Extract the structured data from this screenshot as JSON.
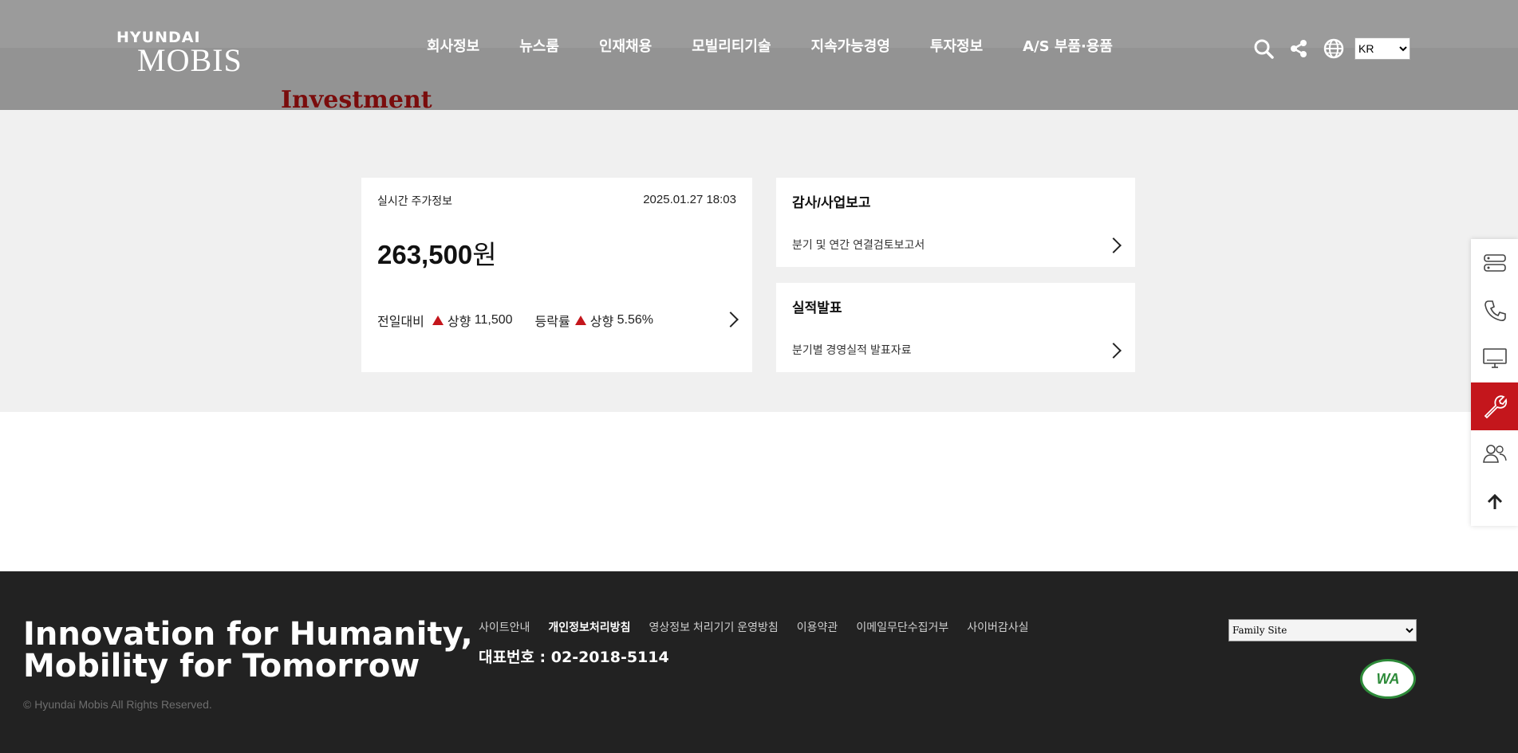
{
  "header": {
    "logo_top": "HYUNDAI",
    "logo_main": "MOBIS",
    "nav": [
      "회사정보",
      "뉴스룸",
      "인재채용",
      "모빌리티기술",
      "지속가능경영",
      "투자정보",
      "A/S 부품·용품"
    ],
    "lang_selected": "KR",
    "icons": [
      "search-icon",
      "share-icon",
      "globe-icon"
    ]
  },
  "page": {
    "heading": "Investment"
  },
  "stock": {
    "label": "실시간 주가정보",
    "datetime": "2025.01.27 18:03",
    "price": "263,500",
    "price_unit": "원",
    "change_label": "전일대비",
    "change_dir": "상향",
    "change_value": "11,500",
    "rate_label": "등락률",
    "rate_dir": "상향",
    "rate_value": "5.56%"
  },
  "reports": [
    {
      "title": "감사/사업보고",
      "link": "분기 및 연간 연결검토보고서"
    },
    {
      "title": "실적발표",
      "link": "분기별 경영실적 발표자료"
    }
  ],
  "quick_menu": {
    "icons": [
      "server-icon",
      "phone-icon",
      "monitor-icon",
      "wrench-icon",
      "users-icon",
      "arrow-up-icon"
    ],
    "active_index": 3
  },
  "footer": {
    "slogan_line1": "Innovation for Humanity,",
    "slogan_line2": "Mobility for Tomorrow",
    "copyright": "© Hyundai Mobis All Rights Reserved.",
    "links": [
      "사이트안내",
      "개인정보처리방침",
      "영상정보 처리기기 운영방침",
      "이용약관",
      "이메일무단수집거부",
      "사이버감사실"
    ],
    "bold_link_index": 1,
    "phone": "대표번호 : 02-2018-5114",
    "family_site": "Family Site",
    "badge_text": "WA"
  },
  "colors": {
    "accent": "#c4161c",
    "header_bg": "#939393",
    "footer_bg": "#222222",
    "band_bg": "#f0f0f0"
  }
}
